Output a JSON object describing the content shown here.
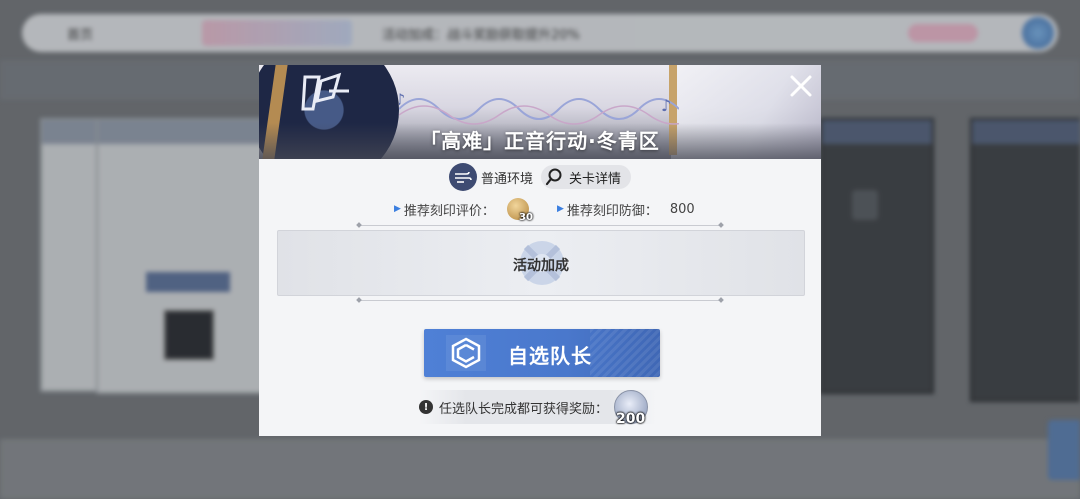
{
  "background": {
    "topbar_left": "首页",
    "topbar_center": "活动加成：战斗奖励获取提升20%"
  },
  "modal": {
    "title": "「高难」正音行动·冬青区",
    "close_icon": "close-icon",
    "environment_label": "普通环境",
    "stage_detail_label": "关卡详情",
    "recommended_rating_label": "推荐刻印评价：",
    "recommended_rating_badge": "30",
    "recommended_defense_label": "推荐刻印防御：",
    "recommended_defense_value": "800",
    "event_bonus_label": "活动加成",
    "select_leader_label": "自选队长",
    "reward_notice": "任选队长完成都可获得奖励：",
    "reward_amount": "200"
  },
  "colors": {
    "primary_button": "#4a78cc",
    "accent_triangle": "#3b7fe0",
    "title_text": "#ffffff"
  }
}
